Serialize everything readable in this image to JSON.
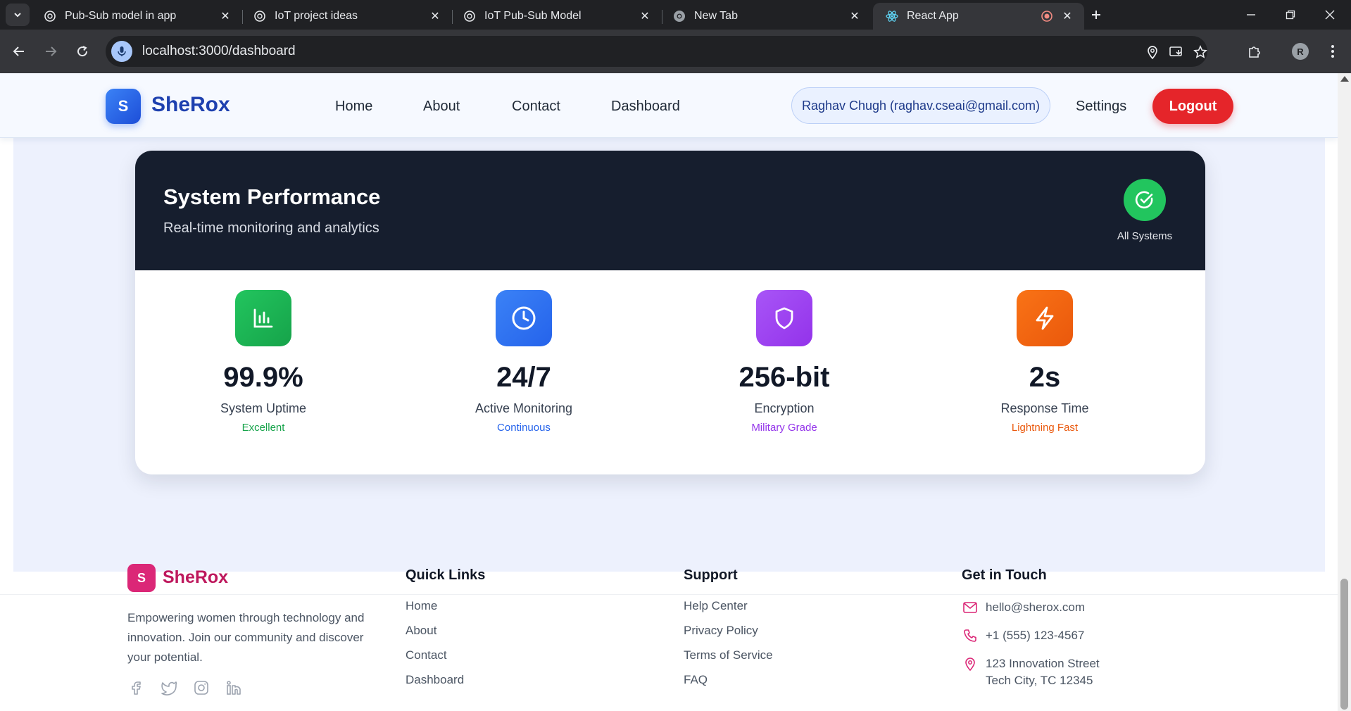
{
  "browser": {
    "tabs": [
      {
        "title": "Pub-Sub model in app",
        "icon": "chatgpt-icon"
      },
      {
        "title": "IoT project ideas",
        "icon": "chatgpt-icon"
      },
      {
        "title": "IoT Pub-Sub Model",
        "icon": "chatgpt-icon"
      },
      {
        "title": "New Tab",
        "icon": "chrome-icon"
      },
      {
        "title": "React App",
        "icon": "react-icon",
        "active": true
      }
    ],
    "url": "localhost:3000/dashboard",
    "profile_initial": "R"
  },
  "header": {
    "logo_letter": "S",
    "brand": "SheRox",
    "nav": [
      "Home",
      "About",
      "Contact",
      "Dashboard"
    ],
    "user": "Raghav Chugh (raghav.cseai@gmail.com)",
    "settings": "Settings",
    "logout": "Logout"
  },
  "performance": {
    "title": "System Performance",
    "subtitle": "Real-time monitoring and analytics",
    "status_label": "All Systems",
    "metrics": [
      {
        "value": "99.9%",
        "label": "System Uptime",
        "note": "Excellent",
        "icon": "bar-chart-icon",
        "color": "#22c55e",
        "note_color": "#16a34a"
      },
      {
        "value": "24/7",
        "label": "Active Monitoring",
        "note": "Continuous",
        "icon": "clock-icon",
        "color": "#3b82f6",
        "note_color": "#2563eb"
      },
      {
        "value": "256-bit",
        "label": "Encryption",
        "note": "Military Grade",
        "icon": "shield-icon",
        "color": "#a855f7",
        "note_color": "#9333ea"
      },
      {
        "value": "2s",
        "label": "Response Time",
        "note": "Lightning Fast",
        "icon": "lightning-icon",
        "color": "#f97316",
        "note_color": "#ea580c"
      }
    ]
  },
  "footer": {
    "logo_letter": "S",
    "brand": "SheRox",
    "about": "Empowering women through technology and innovation. Join our community and discover your potential.",
    "socials": [
      "facebook-icon",
      "twitter-icon",
      "instagram-icon",
      "linkedin-icon"
    ],
    "quick_links": {
      "heading": "Quick Links",
      "items": [
        "Home",
        "About",
        "Contact",
        "Dashboard"
      ]
    },
    "support": {
      "heading": "Support",
      "items": [
        "Help Center",
        "Privacy Policy",
        "Terms of Service",
        "FAQ"
      ]
    },
    "contact": {
      "heading": "Get in Touch",
      "email": "hello@sherox.com",
      "phone": "+1 (555) 123-4567",
      "address_line1": "123 Innovation Street",
      "address_line2": "Tech City, TC 12345"
    }
  },
  "colors": {
    "brand_blue": "#1e40af",
    "logout_red": "#e5252a",
    "footer_pink": "#db2777",
    "dark_header": "#161e2e"
  }
}
